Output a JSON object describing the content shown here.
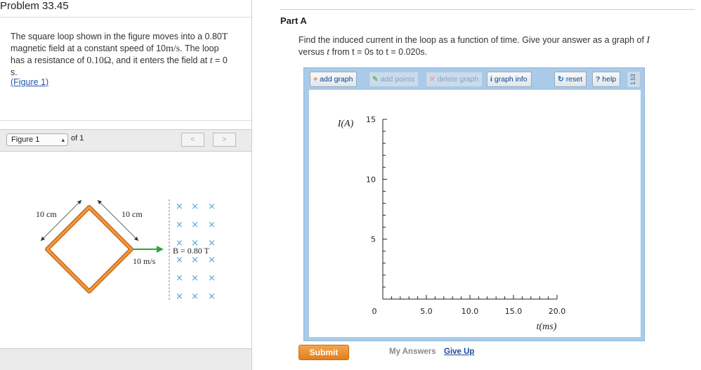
{
  "problem": {
    "title": "Problem 33.45",
    "text_1": "The square loop shown in the figure moves into a 0.80",
    "text_1_unit": "T",
    "text_2": "magnetic field at a constant speed of 10",
    "text_2_unit": "m/s",
    "text_3": ". The loop",
    "text_4": "has a resistance of ",
    "text_4_val": "0.10Ω",
    "text_5": ", and it enters the field at ",
    "text_5_var": "t",
    "text_6": " = 0",
    "text_7": "s.",
    "figure_link": "(Figure 1)"
  },
  "figure_nav": {
    "selected": "Figure 1",
    "of_label": "of 1",
    "prev": "<",
    "next": ">"
  },
  "figure": {
    "label_left_side": "10 cm",
    "label_right_side": "10 cm",
    "field_label": "B = 0.80 T",
    "speed_label": "10 m/s",
    "x_mark": "×",
    "loop_color": "#e07a22",
    "arrow_color": "#22aa44",
    "x_color": "#4aa8d8"
  },
  "part": {
    "title": "Part A",
    "q_1": "Find the induced current in the loop as a function of time. Give your answer as a graph of ",
    "q_var_i": "I",
    "q_2": "versus ",
    "q_var_t": "t",
    "q_3": " from t = 0s to t = 0.020s."
  },
  "toolbar": {
    "add_graph": "add graph",
    "add_points": "add points",
    "delete_graph": "delete graph",
    "graph_info": "graph info",
    "reset": "reset",
    "help": "help",
    "version": "1.53"
  },
  "chart_data": {
    "type": "line",
    "ylabel": "I(A)",
    "xlabel": "t(ms)",
    "yticks": [
      "15",
      "10",
      "5"
    ],
    "xticks": [
      "5.0",
      "10.0",
      "15.0",
      "20.0"
    ],
    "origin_label": "0",
    "ylim": [
      0,
      15
    ],
    "xlim": [
      0,
      20
    ],
    "series": []
  },
  "actions": {
    "submit": "Submit",
    "my_answers": "My Answers",
    "give_up": "Give Up"
  }
}
